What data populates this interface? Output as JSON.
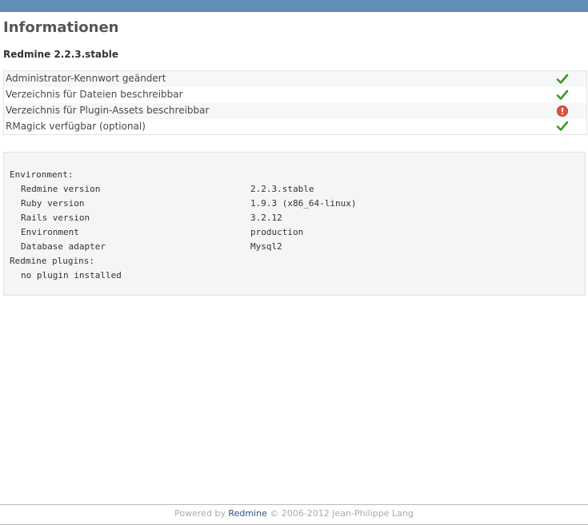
{
  "page": {
    "title": "Informationen",
    "version": "Redmine 2.2.3.stable"
  },
  "checks": [
    {
      "label": "Administrator-Kennwort geändert",
      "status": "ok",
      "icon": "check-icon"
    },
    {
      "label": "Verzeichnis für Dateien beschreibbar",
      "status": "ok",
      "icon": "check-icon"
    },
    {
      "label": "Verzeichnis für Plugin-Assets beschreibbar",
      "status": "error",
      "icon": "exclamation-icon"
    },
    {
      "label": "RMagick verfügbar (optional)",
      "status": "ok",
      "icon": "check-icon"
    }
  ],
  "environment": {
    "header": "Environment:",
    "rows": [
      {
        "key": "Redmine version",
        "value": "2.2.3.stable"
      },
      {
        "key": "Ruby version",
        "value": "1.9.3 (x86_64-linux)"
      },
      {
        "key": "Rails version",
        "value": "3.2.12"
      },
      {
        "key": "Environment",
        "value": "production"
      },
      {
        "key": "Database adapter",
        "value": "Mysql2"
      }
    ],
    "plugins_header": "Redmine plugins:",
    "plugins_value": "no plugin installed"
  },
  "footer": {
    "prefix": "Powered by",
    "link": "Redmine",
    "suffix": "© 2006-2012 Jean-Philippe Lang"
  },
  "colors": {
    "top_bar": "#628db6",
    "ok": "#3a9a2a",
    "error": "#d9534f",
    "link": "#2a5685"
  }
}
